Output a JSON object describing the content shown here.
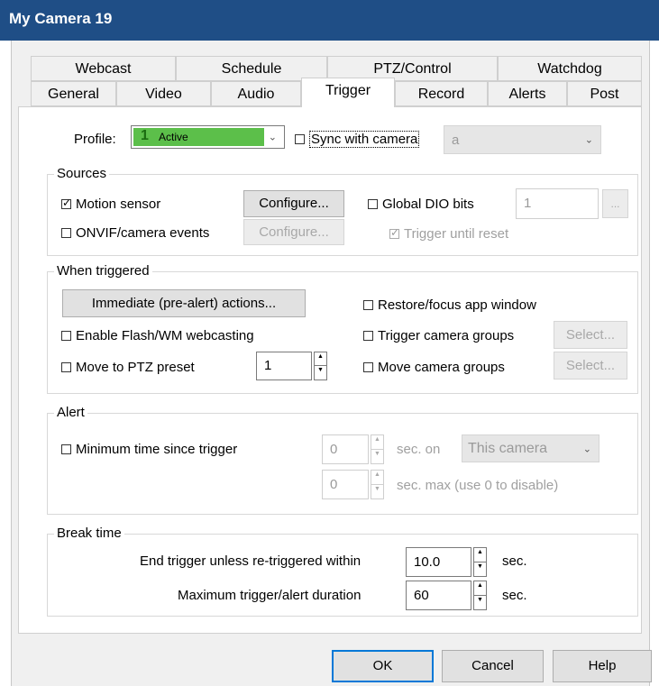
{
  "window": {
    "title": "My Camera 19"
  },
  "tabs_row1": [
    "Webcast",
    "Schedule",
    "PTZ/Control",
    "Watchdog"
  ],
  "tabs_row2": [
    "General",
    "Video",
    "Audio",
    "Trigger",
    "Record",
    "Alerts",
    "Post"
  ],
  "active_tab": "Trigger",
  "profile": {
    "label": "Profile:",
    "number": "1",
    "value": "Active",
    "color": "#5cbf4a",
    "sync_label": "Sync with camera",
    "sync_checked": false,
    "sync_value": "a"
  },
  "sources": {
    "legend": "Sources",
    "motion_label": "Motion sensor",
    "motion_checked": true,
    "configure1": "Configure...",
    "global_dio_label": "Global DIO bits",
    "global_dio_checked": false,
    "global_dio_value": "1",
    "dots": "...",
    "onvif_label": "ONVIF/camera events",
    "onvif_checked": false,
    "configure2": "Configure...",
    "trigger_until_reset_label": "Trigger until reset",
    "trigger_until_reset_checked": true
  },
  "when_triggered": {
    "legend": "When triggered",
    "immediate_btn": "Immediate (pre-alert) actions...",
    "restore_label": "Restore/focus app window",
    "flash_label": "Enable Flash/WM webcasting",
    "trigger_groups_label": "Trigger camera groups",
    "select1": "Select...",
    "ptz_label": "Move to PTZ preset",
    "ptz_value": "1",
    "move_groups_label": "Move camera groups",
    "select2": "Select..."
  },
  "alert": {
    "legend": "Alert",
    "min_time_label": "Minimum time since trigger",
    "value1": "0",
    "sec_on": "sec. on",
    "camera_select": "This camera",
    "value2": "0",
    "sec_max": "sec. max (use 0 to disable)"
  },
  "break_time": {
    "legend": "Break time",
    "end_label": "End trigger unless re-triggered within",
    "end_value": "10.0",
    "end_unit": "sec.",
    "max_label": "Maximum trigger/alert duration",
    "max_value": "60",
    "max_unit": "sec."
  },
  "buttons": {
    "ok": "OK",
    "cancel": "Cancel",
    "help": "Help"
  },
  "colors": {
    "titlebar": "#1f4e86",
    "ok_border": "#0078d7"
  }
}
